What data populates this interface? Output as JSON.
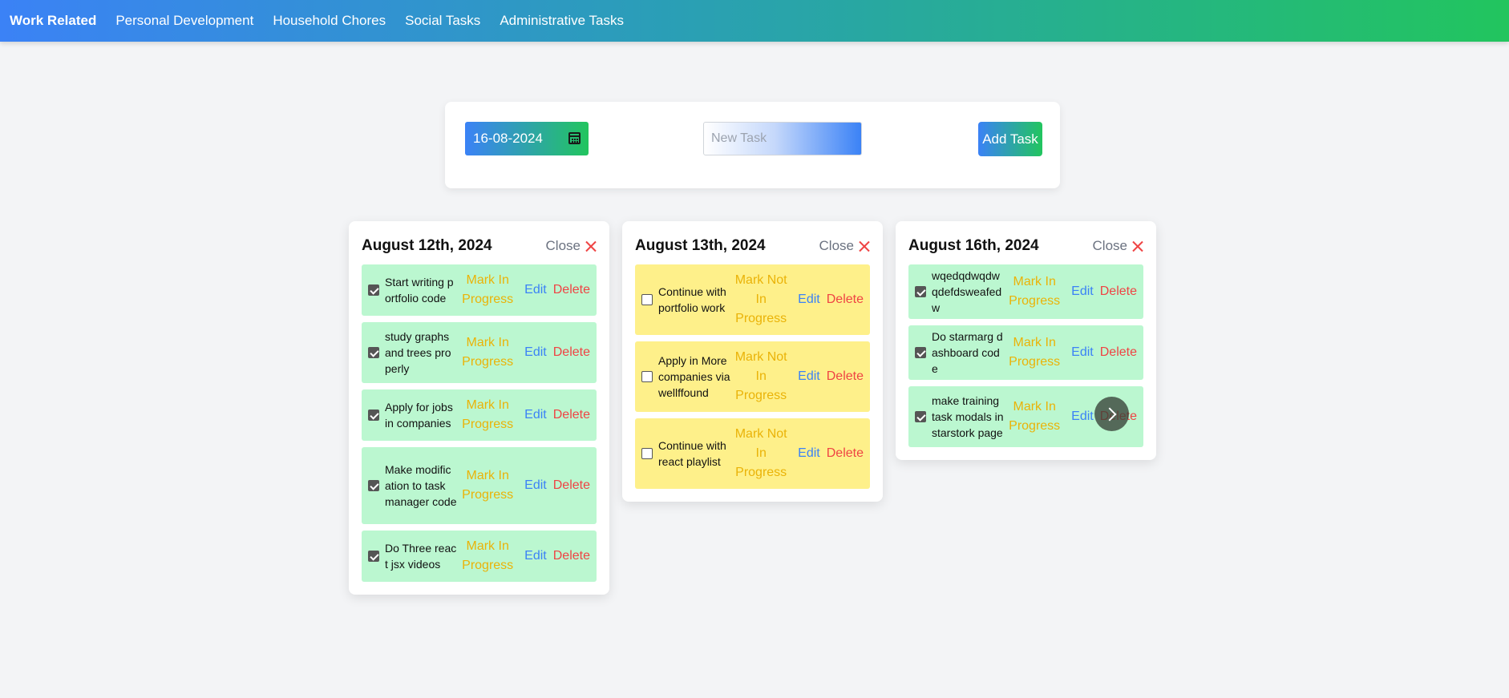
{
  "nav": {
    "items": [
      {
        "label": "Work Related",
        "active": true
      },
      {
        "label": "Personal Development",
        "active": false
      },
      {
        "label": "Household Chores",
        "active": false
      },
      {
        "label": "Social Tasks",
        "active": false
      },
      {
        "label": "Administrative Tasks",
        "active": false
      }
    ]
  },
  "form": {
    "date_value": "16-08-2024",
    "task_placeholder": "New Task",
    "add_label": "Add Task"
  },
  "columns": [
    {
      "title": "August 12th, 2024",
      "close_label": "Close",
      "tasks": [
        {
          "text": "Start writing portfolio code",
          "status_label": "Mark In Progress",
          "done": true
        },
        {
          "text": "study graphs and trees properly",
          "status_label": "Mark In Progress",
          "done": true
        },
        {
          "text": "Apply for jobs in companies",
          "status_label": "Mark In Progress",
          "done": true
        },
        {
          "text": "Make modification to task manager code",
          "status_label": "Mark In Progress",
          "done": true
        },
        {
          "text": "Do Three react jsx videos",
          "status_label": "Mark In Progress",
          "done": true
        }
      ]
    },
    {
      "title": "August 13th, 2024",
      "close_label": "Close",
      "tasks": [
        {
          "text": "Continue with portfolio work",
          "status_label": "Mark Not In Progress",
          "done": false
        },
        {
          "text": "Apply in More companies via wellffound",
          "status_label": "Mark Not In Progress",
          "done": false
        },
        {
          "text": "Continue with react playlist",
          "status_label": "Mark Not In Progress",
          "done": false
        }
      ]
    },
    {
      "title": "August 16th, 2024",
      "close_label": "Close",
      "tasks": [
        {
          "text": "wqedqdwqdwqdefdsweafedw",
          "status_label": "Mark In Progress",
          "done": true
        },
        {
          "text": "Do starmarg dashboard code",
          "status_label": "Mark In Progress",
          "done": true
        },
        {
          "text": "make training task modals in starstork page",
          "status_label": "Mark In Progress",
          "done": true
        }
      ]
    }
  ],
  "task_actions": {
    "edit_label": "Edit",
    "delete_label": "Delete"
  },
  "icons": {
    "calendar": "calendar-icon",
    "close": "close-icon",
    "next": "chevron-right-icon"
  },
  "colors": {
    "gradient_start": "#3b82f6",
    "gradient_end": "#22c55e",
    "done_bg": "#bbf7d0",
    "pending_bg": "#fef08a",
    "status_text": "#eab308",
    "edit_text": "#3b82f6",
    "delete_text": "#ef4444"
  }
}
